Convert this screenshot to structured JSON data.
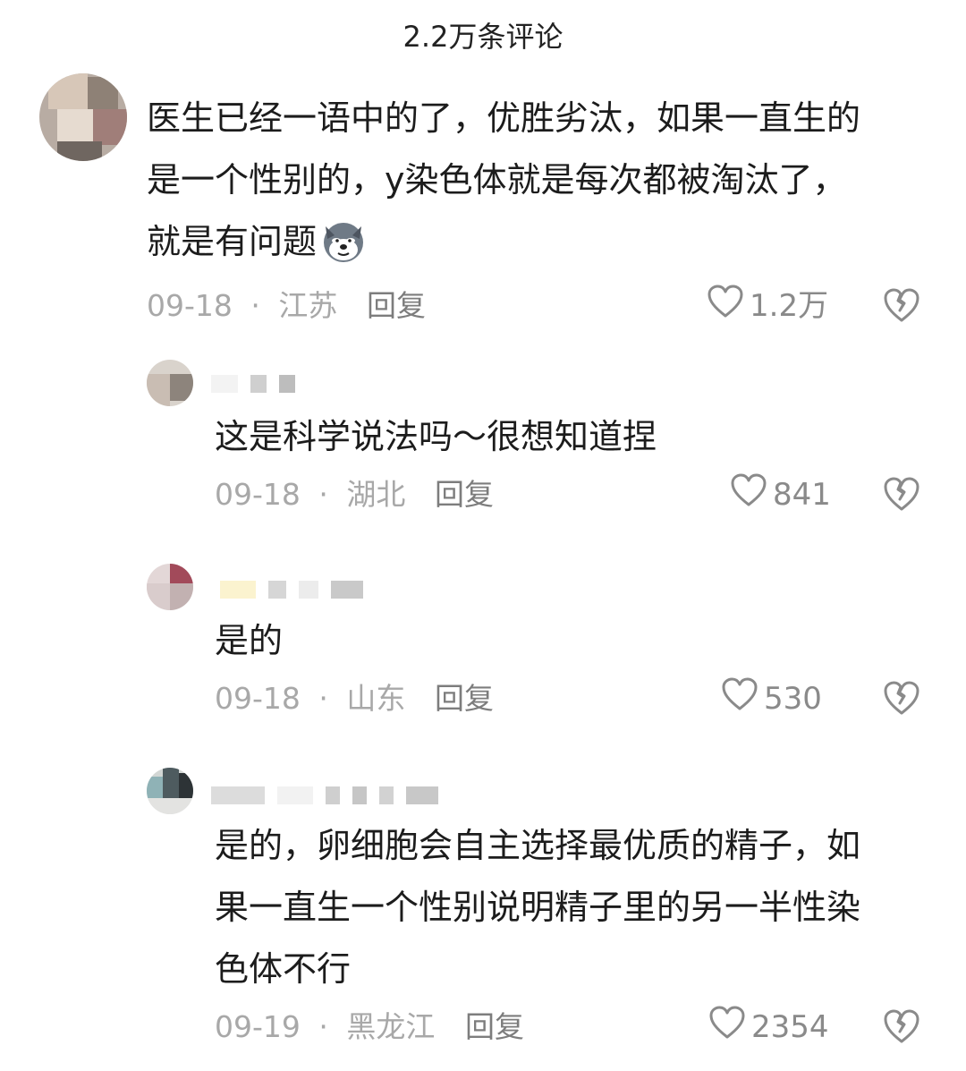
{
  "header": {
    "title": "2.2万条评论"
  },
  "comments": [
    {
      "text": "医生已经一语中的了，优胜劣汰，如果一直生的\n是一个性别的，y染色体就是每次都被淘汰了，\n就是有问题",
      "emoji_icon": "husky-dog-emoji",
      "date": "09-18",
      "sep": "·",
      "location": "江苏",
      "reply_label": "回复",
      "likes": "1.2万"
    },
    {
      "text": "这是科学说法吗～很想知道捏",
      "date": "09-18",
      "sep": "·",
      "location": "湖北",
      "reply_label": "回复",
      "likes": "841"
    },
    {
      "text": "是的",
      "date": "09-18",
      "sep": "·",
      "location": "山东",
      "reply_label": "回复",
      "likes": "530"
    },
    {
      "text": "是的，卵细胞会自主选择最优质的精子，如\n果一直生一个性别说明精子里的另一半性染\n色体不行",
      "date": "09-19",
      "sep": "·",
      "location": "黑龙江",
      "reply_label": "回复",
      "likes": "2354"
    }
  ]
}
